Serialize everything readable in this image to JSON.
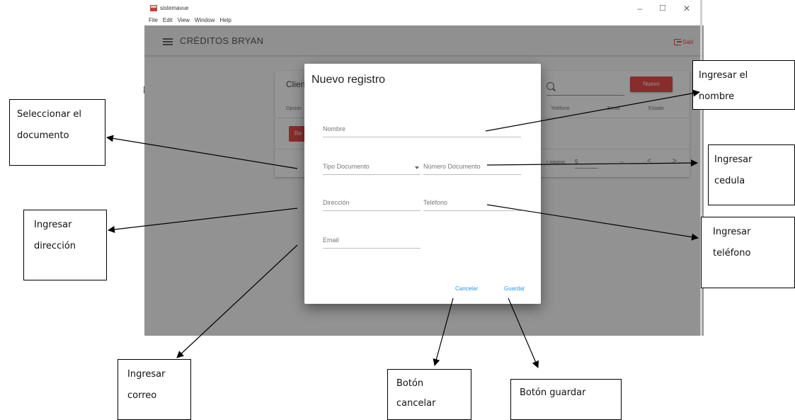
{
  "window": {
    "app_name": "sistemavue",
    "menu": [
      "File",
      "Edit",
      "View",
      "Window",
      "Help"
    ],
    "controls": {
      "minimize": "–",
      "maximize": "☐",
      "close": "✕"
    }
  },
  "toolbar": {
    "title": "CRÉDITOS BRYAN",
    "logout_label": "Salir"
  },
  "background_table": {
    "title": "Clien",
    "new_button": "Nuevo",
    "columns": [
      "Opcion",
      "Teléfono",
      "Email",
      "Estado"
    ],
    "reset_button": "Re",
    "rows_per_page_label": "r página:",
    "rows_per_page_value": "5",
    "range": "–",
    "prev": "<",
    "next": ">"
  },
  "dialog": {
    "title": "Nuevo registro",
    "fields": {
      "nombre": "Nombre",
      "tipo_documento": "Tipo Documento",
      "numero_documento": "Número Documento",
      "direccion": "Dirección",
      "telefono": "Teléfono",
      "email": "Email"
    },
    "cancel_label": "Cancelar",
    "save_label": "Guardar"
  },
  "annotations": {
    "nombre": "Ingresar     el\nnombre",
    "documento": "Seleccionar el\ndocumento",
    "cedula": "Ingresar\ncedula",
    "direccion": "Ingresar\ndirección",
    "telefono": "Ingresar\nteléfono",
    "correo": "Ingresar\ncorreo",
    "cancelar": "Botón\ncancelar",
    "guardar": "Botón guardar"
  },
  "colors": {
    "accent_red": "#e53935",
    "link_blue": "#2196f3"
  }
}
